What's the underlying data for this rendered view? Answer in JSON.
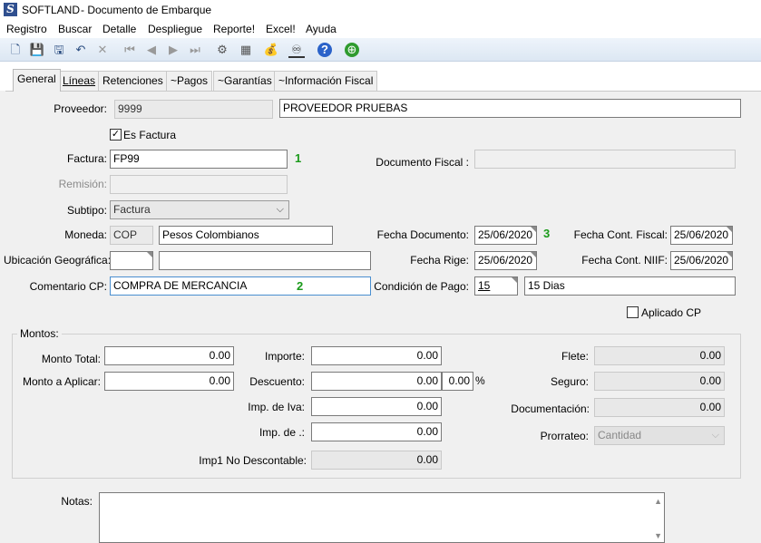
{
  "window": {
    "app_name": "SOFTLAND",
    "doc_title": "- Documento de Embarque",
    "app_icon_letter": "S"
  },
  "menu": [
    "Registro",
    "Buscar",
    "Detalle",
    "Despliegue",
    "Reporte!",
    "Excel!",
    "Ayuda"
  ],
  "toolbar": {
    "icons": [
      "new-icon",
      "save-icon",
      "save-as-icon",
      "undo-icon",
      "delete-icon",
      "first-record-icon",
      "previous-record-icon",
      "next-record-icon",
      "last-record-icon",
      "process-icon",
      "grid-icon",
      "money-bag-icon",
      "binoculars-icon",
      "help-icon",
      "exit-icon"
    ],
    "glyphs": [
      "🗋",
      "💾",
      "🖫",
      "↶",
      "✕",
      "⏮",
      "◀",
      "▶",
      "⏭",
      "⚙",
      "▦",
      "💰",
      "♾",
      "?",
      "⊕"
    ]
  },
  "tabs": [
    "General",
    "Líneas",
    "Retenciones",
    "~Pagos",
    "~Garantías",
    "~Información Fiscal"
  ],
  "form": {
    "proveedor_label": "Proveedor:",
    "proveedor_code": "9999",
    "proveedor_name": "PROVEEDOR PRUEBAS",
    "es_factura_label": "Es Factura",
    "es_factura_checked": "✓",
    "factura_label": "Factura:",
    "factura_value": "FP99",
    "annot_1": "1",
    "doc_fiscal_label": "Documento Fiscal :",
    "doc_fiscal_value": "",
    "remision_label": "Remisión:",
    "remision_value": "",
    "subtipo_label": "Subtipo:",
    "subtipo_value": "Factura",
    "moneda_label": "Moneda:",
    "moneda_code": "COP",
    "moneda_name": "Pesos Colombianos",
    "fecha_doc_label": "Fecha Documento:",
    "fecha_doc_value": "25/06/2020",
    "annot_3": "3",
    "fecha_cont_fiscal_label": "Fecha Cont. Fiscal:",
    "fecha_cont_fiscal_value": "25/06/2020",
    "ubicacion_label": "Ubicación Geográfica:",
    "ubicacion_code": "",
    "ubicacion_name": "",
    "fecha_rige_label": "Fecha Rige:",
    "fecha_rige_value": "25/06/2020",
    "fecha_cont_niif_label": "Fecha Cont. NIIF:",
    "fecha_cont_niif_value": "25/06/2020",
    "comentario_label": "Comentario CP:",
    "comentario_value": "COMPRA DE MERCANCIA",
    "annot_2": "2",
    "condicion_label": "Condición de Pago:",
    "condicion_code": "15",
    "condicion_desc": "15 Dias",
    "aplicado_label": "Aplicado CP"
  },
  "montos": {
    "title": "Montos:",
    "monto_total_label": "Monto Total:",
    "monto_total": "0.00",
    "monto_aplicar_label": "Monto a Aplicar:",
    "monto_aplicar": "0.00",
    "importe_label": "Importe:",
    "importe": "0.00",
    "descuento_label": "Descuento:",
    "descuento": "0.00",
    "descuento_pct": "0.00",
    "pct_symbol": "%",
    "imp_iva_label": "Imp. de Iva:",
    "imp_iva": "0.00",
    "imp_de_label": "Imp. de .:",
    "imp_de": "0.00",
    "imp1_label": "Imp1 No Descontable:",
    "imp1": "0.00",
    "flete_label": "Flete:",
    "flete": "0.00",
    "seguro_label": "Seguro:",
    "seguro": "0.00",
    "documentacion_label": "Documentación:",
    "documentacion": "0.00",
    "prorrateo_label": "Prorrateo:",
    "prorrateo": "Cantidad"
  },
  "notas": {
    "label": "Notas:",
    "value": ""
  }
}
